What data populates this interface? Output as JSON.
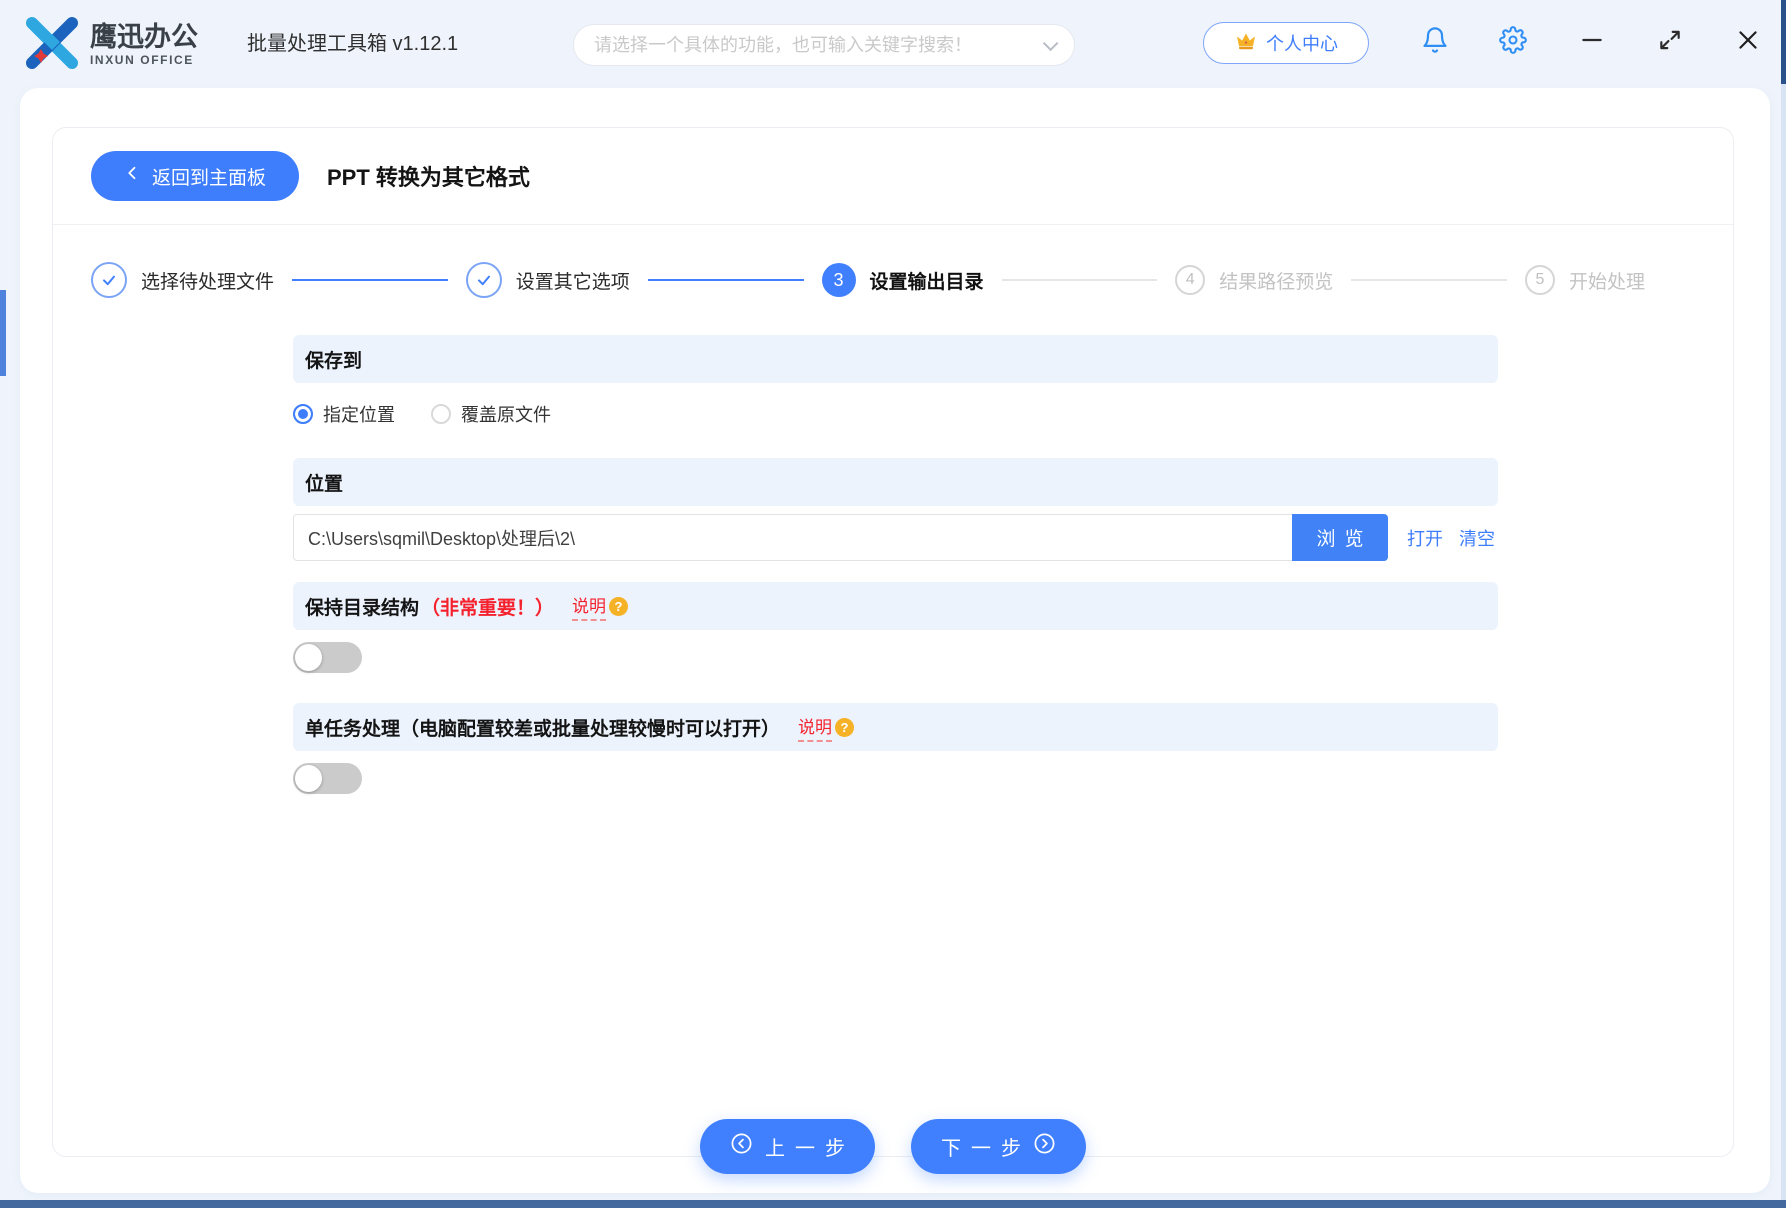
{
  "header": {
    "brand": {
      "name": "鹰迅办公",
      "name_en": "INXUN OFFICE"
    },
    "app_title": "批量处理工具箱 v1.12.1",
    "search": {
      "placeholder": "请选择一个具体的功能，也可输入关键字搜索！"
    },
    "user_center_label": "个人中心"
  },
  "page": {
    "back_label": "返回到主面板",
    "title": "PPT 转换为其它格式"
  },
  "steps": [
    {
      "label": "选择待处理文件",
      "state": "done"
    },
    {
      "label": "设置其它选项",
      "state": "done"
    },
    {
      "number": "3",
      "label": "设置输出目录",
      "state": "current"
    },
    {
      "number": "4",
      "label": "结果路径预览",
      "state": "pending"
    },
    {
      "number": "5",
      "label": "开始处理",
      "state": "pending"
    }
  ],
  "form": {
    "save_to": {
      "title": "保存到",
      "option_specified": "指定位置",
      "option_overwrite": "覆盖原文件",
      "selected": "指定位置"
    },
    "location": {
      "title": "位置",
      "path": "C:\\Users\\sqmil\\Desktop\\处理后\\2\\",
      "browse_label": "浏览",
      "open_label": "打开",
      "clear_label": "清空"
    },
    "keep_structure": {
      "title": "保持目录结构",
      "highlight": "（非常重要！）",
      "help_label": "说明",
      "enabled": false
    },
    "single_task": {
      "title": "单任务处理（电脑配置较差或批量处理较慢时可以打开）",
      "help_label": "说明",
      "enabled": false
    }
  },
  "footer": {
    "prev_label": "上一步",
    "next_label": "下一步"
  },
  "icons": {
    "question": "?"
  },
  "colors": {
    "primary": "#3e7dfc",
    "browse_blue": "#4183f6",
    "band_bg": "#edf3fd",
    "red": "#f5222d",
    "orange": "#f6b226",
    "icon_blue": "#2f8ef3"
  }
}
